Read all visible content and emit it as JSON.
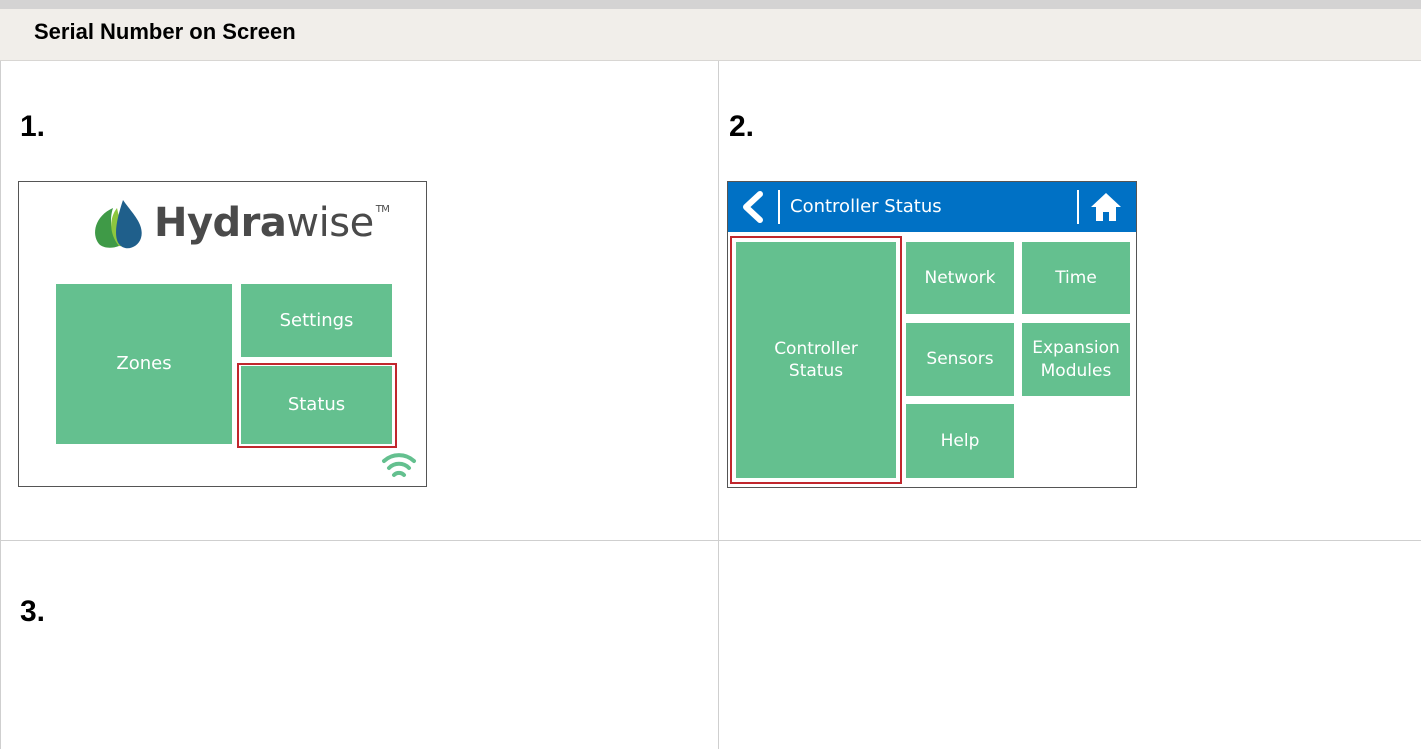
{
  "header": {
    "title": "Serial Number on Screen"
  },
  "steps": {
    "s1": "1.",
    "s2": "2.",
    "s3": "3."
  },
  "screen1": {
    "brand_bold": "Hydra",
    "brand_light": "wise",
    "brand_tm": "TM",
    "tiles": {
      "zones": "Zones",
      "settings": "Settings",
      "status": "Status"
    },
    "icons": [
      "hydrawise-logo-icon",
      "wifi-icon"
    ]
  },
  "screen2": {
    "title": "Controller Status",
    "tiles": {
      "controller_status_line1": "Controller",
      "controller_status_line2": "Status",
      "network": "Network",
      "time": "Time",
      "sensors": "Sensors",
      "expansion_line1": "Expansion",
      "expansion_line2": "Modules",
      "help": "Help"
    },
    "icons": [
      "back-arrow-icon",
      "home-icon"
    ]
  },
  "colors": {
    "tile_green": "#64c08f",
    "highlight_red": "#c1272d",
    "title_bar_blue": "#0071c5",
    "header_bg": "#f1eeea"
  }
}
